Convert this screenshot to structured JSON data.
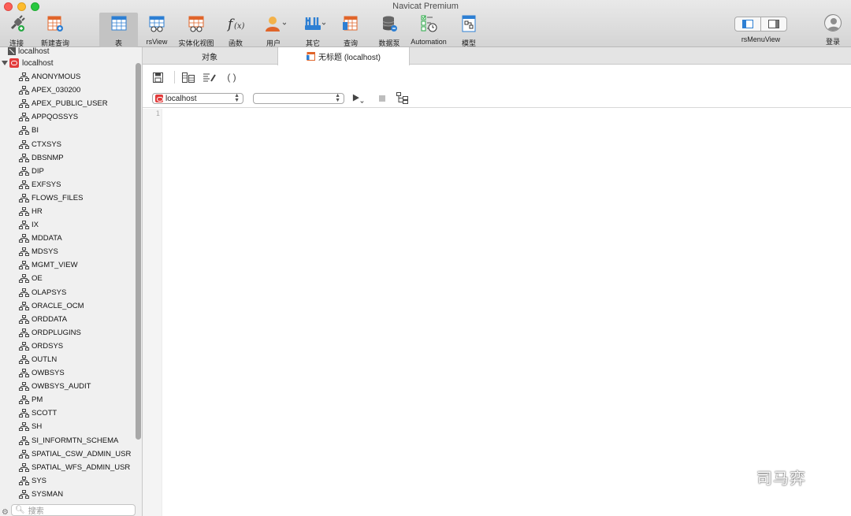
{
  "window": {
    "title": "Navicat Premium"
  },
  "toolbar": {
    "items": [
      {
        "label": "连接",
        "icon": "connect-plug-icon"
      },
      {
        "label": "新建查询",
        "icon": "new-query-icon"
      },
      {
        "label": "表",
        "icon": "table-icon"
      },
      {
        "label": "rsView",
        "icon": "view-icon"
      },
      {
        "label": "实体化视图",
        "icon": "materialized-view-icon"
      },
      {
        "label": "函数",
        "icon": "function-icon"
      },
      {
        "label": "用户",
        "icon": "user-icon"
      },
      {
        "label": "其它",
        "icon": "tools-icon"
      },
      {
        "label": "查询",
        "icon": "query-icon"
      },
      {
        "label": "数据泵",
        "icon": "data-pump-icon"
      },
      {
        "label": "Automation",
        "icon": "automation-icon"
      },
      {
        "label": "模型",
        "icon": "model-icon"
      }
    ],
    "active_item": "表",
    "view_toggle_label": "rsMenuView",
    "login_label": "登录"
  },
  "sidebar": {
    "top_connection": "localhost",
    "connection": "localhost",
    "schemas": [
      "ANONYMOUS",
      "APEX_030200",
      "APEX_PUBLIC_USER",
      "APPQOSSYS",
      "BI",
      "CTXSYS",
      "DBSNMP",
      "DIP",
      "EXFSYS",
      "FLOWS_FILES",
      "HR",
      "IX",
      "MDDATA",
      "MDSYS",
      "MGMT_VIEW",
      "OE",
      "OLAPSYS",
      "ORACLE_OCM",
      "ORDDATA",
      "ORDPLUGINS",
      "ORDSYS",
      "OUTLN",
      "OWBSYS",
      "OWBSYS_AUDIT",
      "PM",
      "SCOTT",
      "SH",
      "SI_INFORMTN_SCHEMA",
      "SPATIAL_CSW_ADMIN_USR",
      "SPATIAL_WFS_ADMIN_USR",
      "SYS",
      "SYSMAN"
    ],
    "search_placeholder": "搜索"
  },
  "tabs": [
    {
      "label": "对象",
      "active": false
    },
    {
      "label": "无标题 (localhost)",
      "active": true
    }
  ],
  "editor": {
    "connection_select": "localhost",
    "schema_select": "",
    "line_numbers": [
      "1"
    ]
  },
  "watermark": {
    "text": "司马弈"
  },
  "colors": {
    "accent_red": "#e23b3b",
    "toolbar_active": "#c3c3c3"
  }
}
